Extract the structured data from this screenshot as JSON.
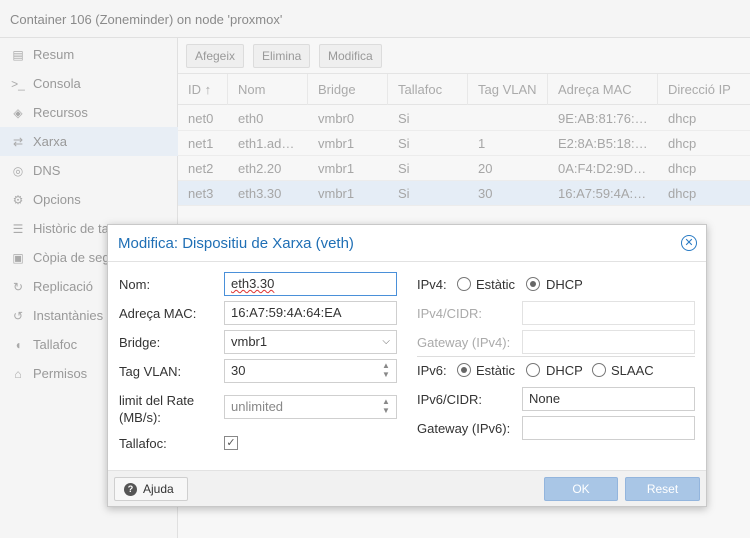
{
  "page_title": "Container 106 (Zoneminder) on node 'proxmox'",
  "sidebar": {
    "items": [
      {
        "label": "Resum",
        "icon": "book-icon",
        "glyph": "▤"
      },
      {
        "label": "Consola",
        "icon": "terminal-icon",
        "glyph": ">_"
      },
      {
        "label": "Recursos",
        "icon": "cube-icon",
        "glyph": "◈"
      },
      {
        "label": "Xarxa",
        "icon": "exchange-icon",
        "glyph": "⇄"
      },
      {
        "label": "DNS",
        "icon": "globe-icon",
        "glyph": "◎"
      },
      {
        "label": "Opcions",
        "icon": "gear-icon",
        "glyph": "⚙"
      },
      {
        "label": "Històric de ta",
        "icon": "list-icon",
        "glyph": "☰"
      },
      {
        "label": "Còpia de seg",
        "icon": "floppy-icon",
        "glyph": "▣"
      },
      {
        "label": "Replicació",
        "icon": "retweet-icon",
        "glyph": "↻"
      },
      {
        "label": "Instantànies",
        "icon": "history-icon",
        "glyph": "↺"
      },
      {
        "label": "Tallafoc",
        "icon": "shield-icon",
        "glyph": "◖"
      },
      {
        "label": "Permisos",
        "icon": "unlock-icon",
        "glyph": "⌂"
      }
    ]
  },
  "toolbar": {
    "add": "Afegeix",
    "remove": "Elimina",
    "edit": "Modifica"
  },
  "grid": {
    "headers": [
      "ID ↑",
      "Nom",
      "Bridge",
      "Tallafoc",
      "Tag VLAN",
      "Adreça MAC",
      "Direcció IP"
    ],
    "rows": [
      [
        "net0",
        "eth0",
        "vmbr0",
        "Si",
        "",
        "9E:AB:81:76:…",
        "dhcp"
      ],
      [
        "net1",
        "eth1.ad…",
        "vmbr1",
        "Si",
        "1",
        "E2:8A:B5:18:…",
        "dhcp"
      ],
      [
        "net2",
        "eth2.20",
        "vmbr1",
        "Si",
        "20",
        "0A:F4:D2:9D…",
        "dhcp"
      ],
      [
        "net3",
        "eth3.30",
        "vmbr1",
        "Si",
        "30",
        "16:A7:59:4A:…",
        "dhcp"
      ]
    ]
  },
  "modal": {
    "title": "Modifica: Dispositiu de Xarxa (veth)",
    "close_glyph": "✕",
    "left": {
      "name_label": "Nom:",
      "name_value": "eth3.30",
      "mac_label": "Adreça MAC:",
      "mac_value": "16:A7:59:4A:64:EA",
      "bridge_label": "Bridge:",
      "bridge_value": "vmbr1",
      "vlan_label": "Tag VLAN:",
      "vlan_value": "30",
      "rate_label_1": "limit del Rate",
      "rate_label_2": "(MB/s):",
      "rate_placeholder": "unlimited",
      "firewall_label": "Tallafoc:",
      "firewall_checked": true
    },
    "right": {
      "ipv4_label": "IPv4:",
      "ipv4_static": "Estàtic",
      "ipv4_dhcp": "DHCP",
      "ipv4_selected": "DHCP",
      "ipv4_cidr_label": "IPv4/CIDR:",
      "ipv4_gw_label": "Gateway (IPv4):",
      "ipv6_label": "IPv6:",
      "ipv6_static": "Estàtic",
      "ipv6_dhcp": "DHCP",
      "ipv6_slaac": "SLAAC",
      "ipv6_selected": "Estàtic",
      "ipv6_cidr_label": "IPv6/CIDR:",
      "ipv6_cidr_value": "None",
      "ipv6_gw_label": "Gateway (IPv6):"
    },
    "footer": {
      "help": "Ajuda",
      "ok": "OK",
      "reset": "Reset"
    }
  }
}
